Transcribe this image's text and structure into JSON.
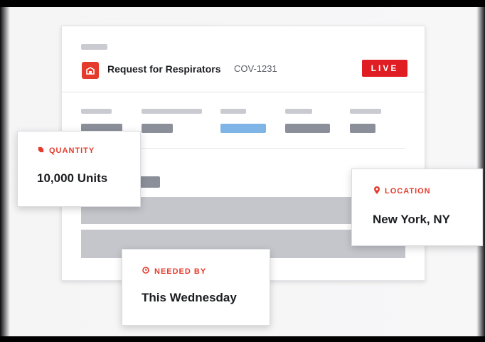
{
  "request": {
    "title": "Request for Respirators",
    "code": "COV-1231",
    "status": "LIVE",
    "icon": "box-icon"
  },
  "callouts": {
    "quantity": {
      "label": "QUANTITY",
      "value": "10,000 Units",
      "icon": "tag-icon"
    },
    "location": {
      "label": "LOCATION",
      "value": "New York, NY",
      "icon": "map-pin-icon"
    },
    "needed_by": {
      "label": "NEEDED BY",
      "value": "This Wednesday",
      "icon": "clock-icon"
    }
  },
  "colors": {
    "accent": "#e53b2c",
    "live_badge": "#e11d24",
    "placeholder_gray": "#c9cbd1",
    "placeholder_dark": "#8b8f99",
    "placeholder_blue": "#7fb4e6"
  }
}
